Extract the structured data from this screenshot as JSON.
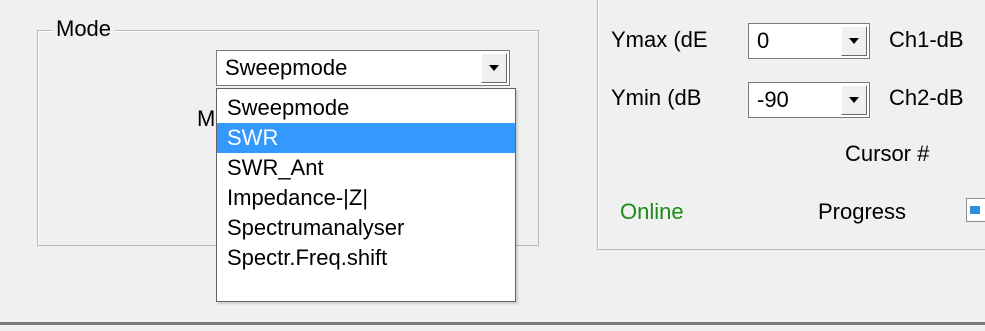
{
  "mode_group": {
    "title": "Mode",
    "selected": "Sweepmode",
    "hidden_label_fragment": "M",
    "options": [
      {
        "label": "Sweepmode",
        "highlighted": false
      },
      {
        "label": "SWR",
        "highlighted": true
      },
      {
        "label": "SWR_Ant",
        "highlighted": false
      },
      {
        "label": "Impedance-|Z|",
        "highlighted": false
      },
      {
        "label": "Spectrumanalyser",
        "highlighted": false
      },
      {
        "label": "Spectr.Freq.shift",
        "highlighted": false
      }
    ]
  },
  "display_group": {
    "ymax_label": "Ymax (dE",
    "ymax_value": "0",
    "ymin_label": "Ymin (dB",
    "ymin_value": "-90",
    "ch1_label": "Ch1-dB",
    "ch2_label": "Ch2-dB",
    "cursor_label": "Cursor #",
    "status_text": "Online",
    "progress_label": "Progress"
  },
  "colors": {
    "status_online": "#1a8c1a",
    "highlight": "#3399ff"
  }
}
